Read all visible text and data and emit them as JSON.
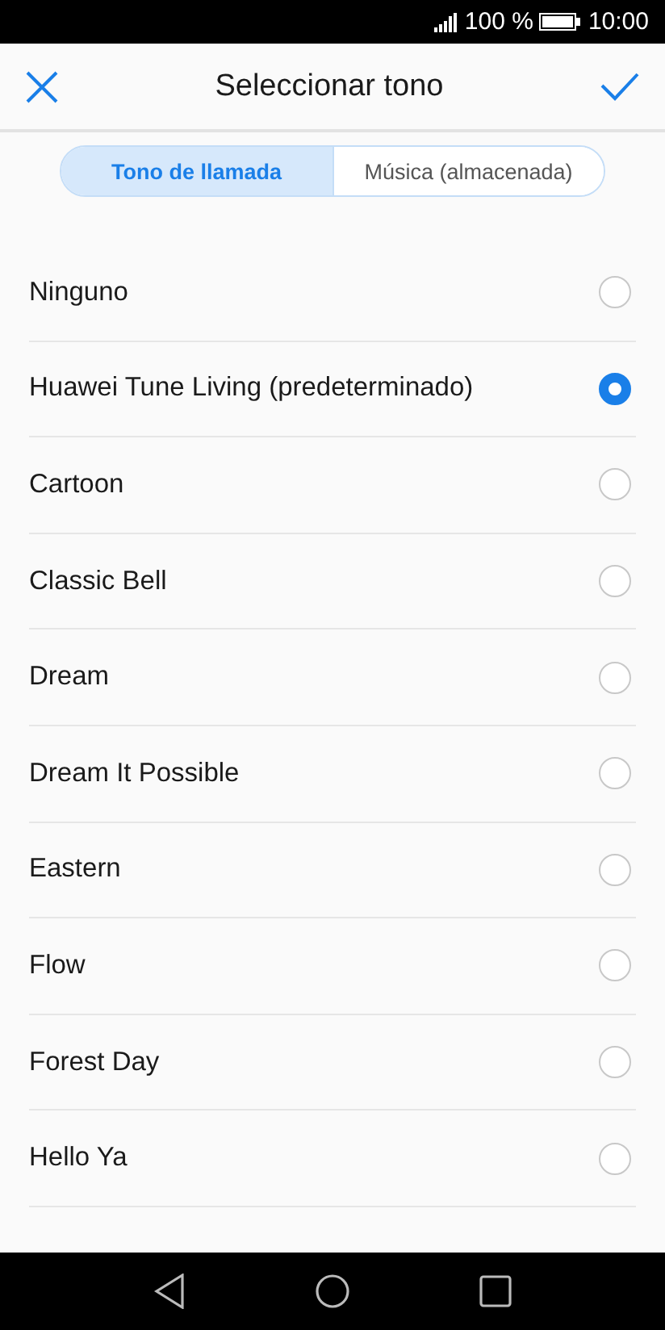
{
  "status_bar": {
    "battery_text": "100 %",
    "time": "10:00"
  },
  "header": {
    "title": "Seleccionar tono"
  },
  "tabs": [
    {
      "label": "Tono de llamada",
      "selected": true
    },
    {
      "label": "Música (almacenada)",
      "selected": false
    }
  ],
  "tones": [
    {
      "name": "Ninguno",
      "selected": false
    },
    {
      "name": "Huawei Tune Living (predeterminado)",
      "selected": true
    },
    {
      "name": "Cartoon",
      "selected": false
    },
    {
      "name": "Classic Bell",
      "selected": false
    },
    {
      "name": "Dream",
      "selected": false
    },
    {
      "name": "Dream It Possible",
      "selected": false
    },
    {
      "name": "Eastern",
      "selected": false
    },
    {
      "name": "Flow",
      "selected": false
    },
    {
      "name": "Forest Day",
      "selected": false
    },
    {
      "name": "Hello Ya",
      "selected": false
    }
  ]
}
